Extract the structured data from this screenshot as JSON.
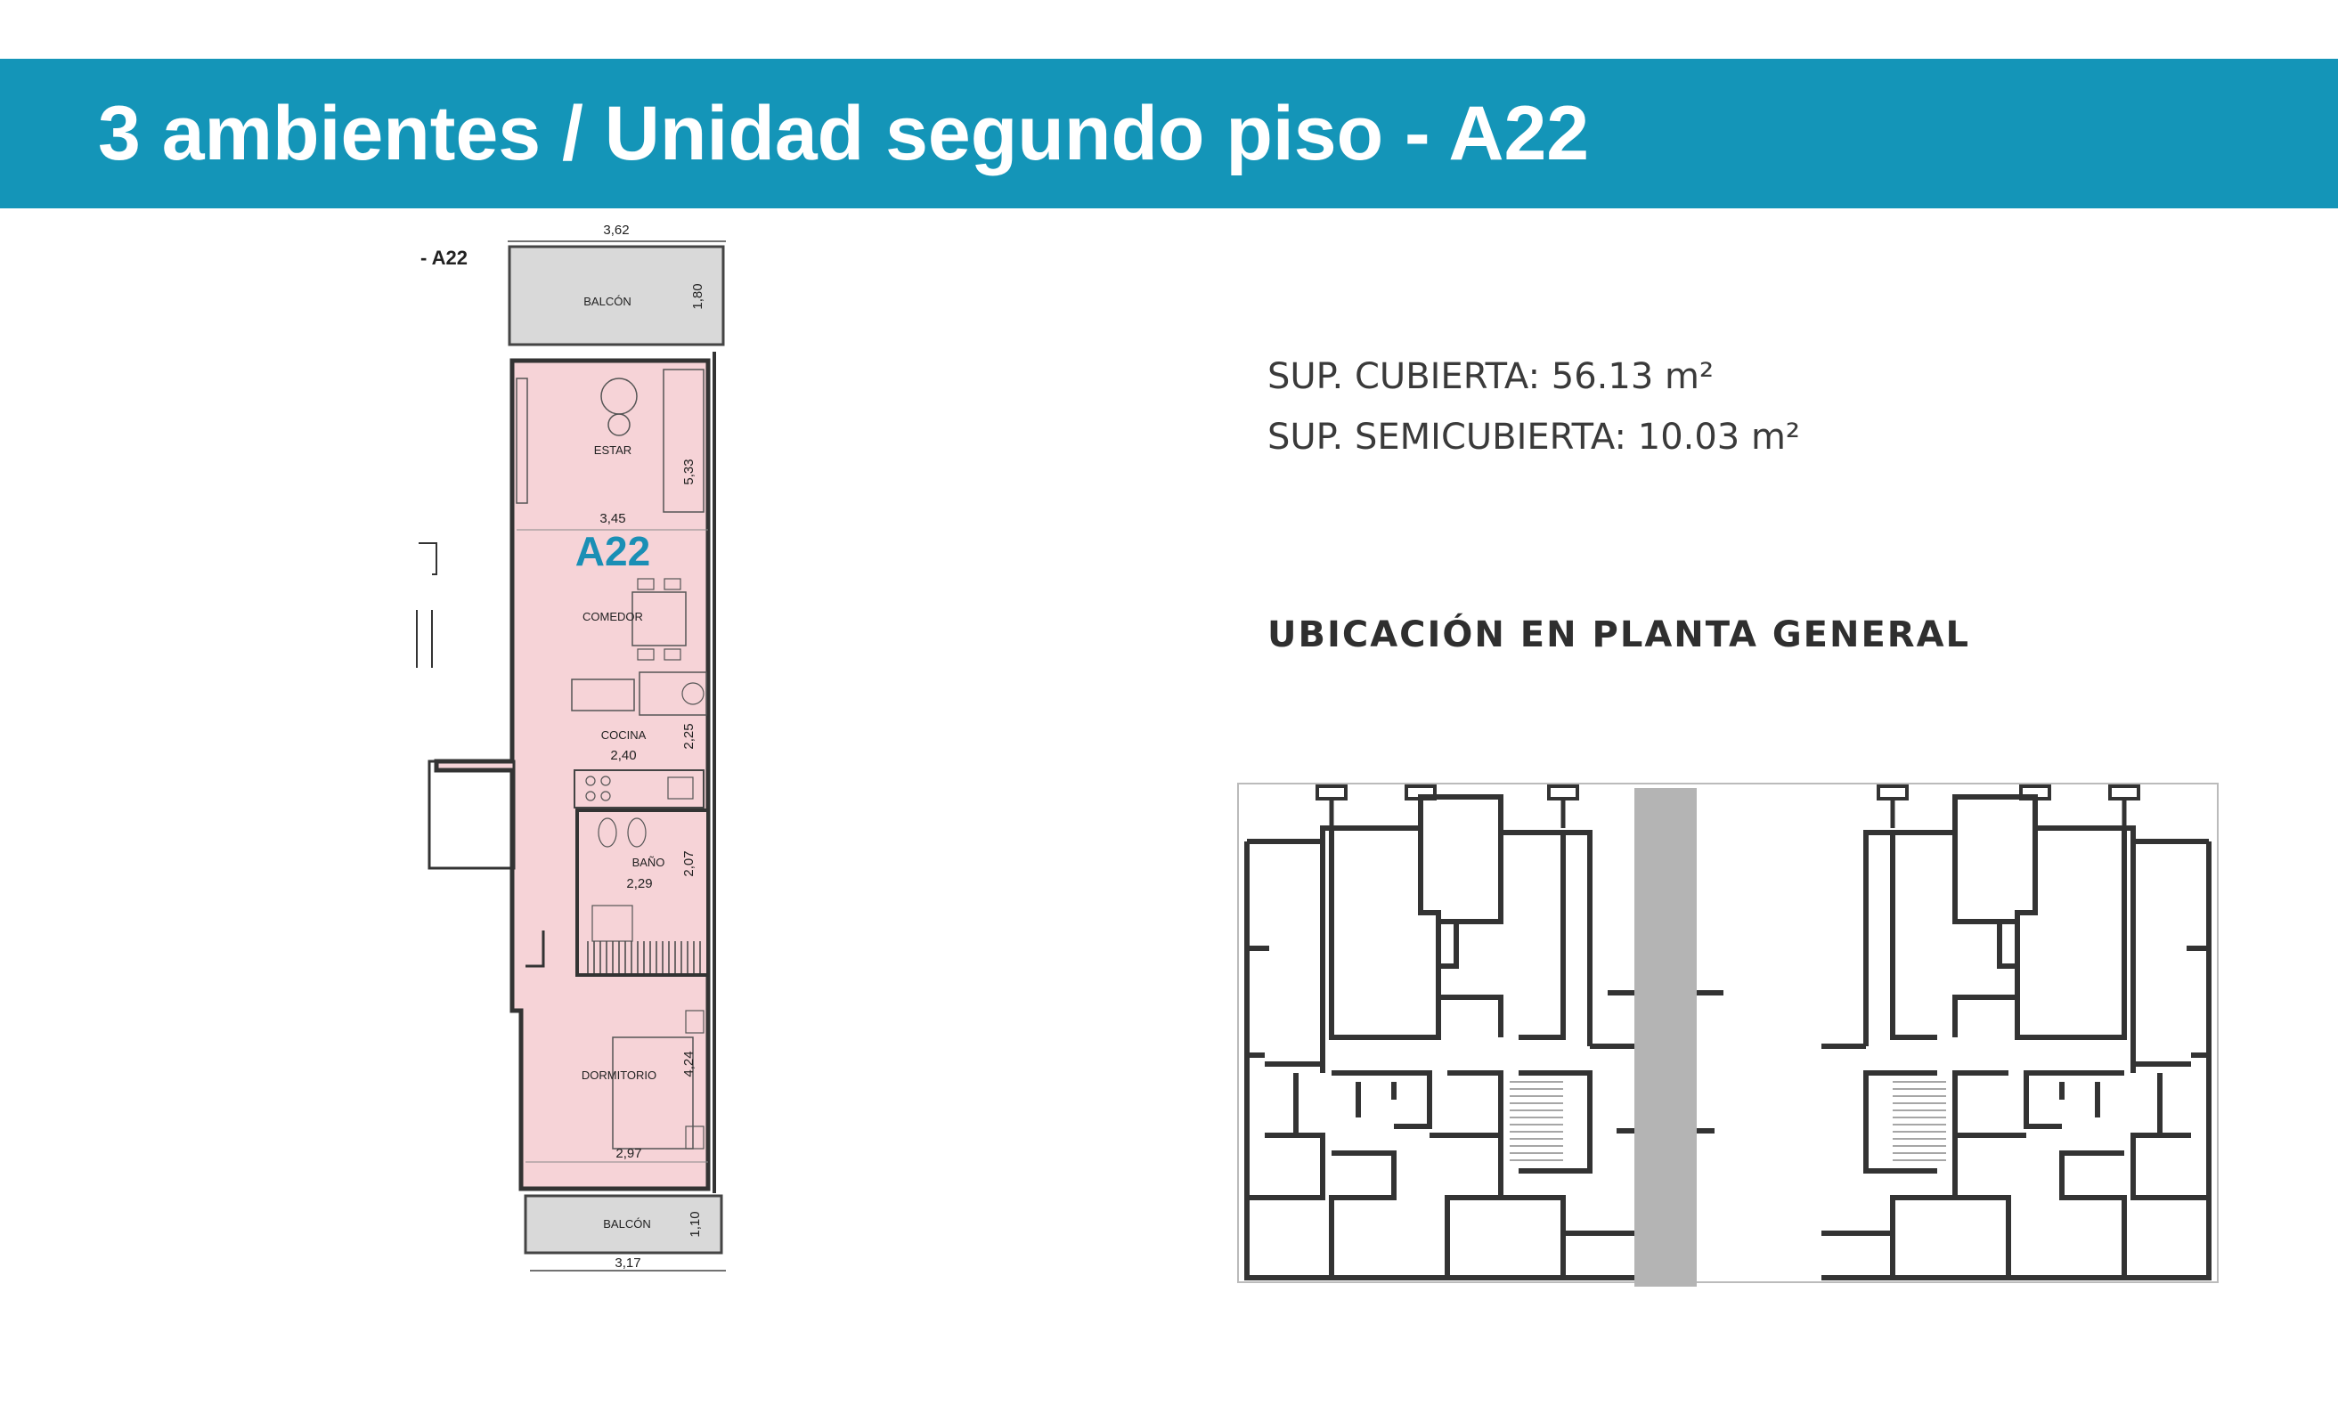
{
  "header": {
    "title": "3 ambientes / Unidad segundo piso - A22"
  },
  "info": {
    "sup_cubierta": "SUP. CUBIERTA: 56.13 m²",
    "sup_semicubierta": "SUP. SEMICUBIERTA: 10.03 m²"
  },
  "location_title": "UBICACIÓN EN PLANTA GENERAL",
  "plan": {
    "tag": "- A22",
    "unit_label": "A22",
    "unit_color": "#f6d3d7",
    "unit_label_color": "#1a8fb5",
    "rooms": {
      "balcon_top": "BALCÓN",
      "estar": "ESTAR",
      "comedor": "COMEDOR",
      "cocina": "COCINA",
      "bano": "BAÑO",
      "dormitorio": "DORMITORIO",
      "balcon_bottom": "BALCÓN"
    },
    "dims": {
      "top_width": "3,62",
      "balcon_top_depth": "1,80",
      "estar_depth": "5,33",
      "estar_width": "3,45",
      "cocina_depth": "2,25",
      "cocina_width": "2,40",
      "bano_depth": "2,07",
      "bano_width": "2,29",
      "dorm_depth": "4,24",
      "dorm_width": "2,97",
      "balcon_bottom_depth": "1,10",
      "bottom_width": "3,17"
    }
  },
  "colors": {
    "banner": "#1495b8",
    "core": "#b4b4b4"
  }
}
